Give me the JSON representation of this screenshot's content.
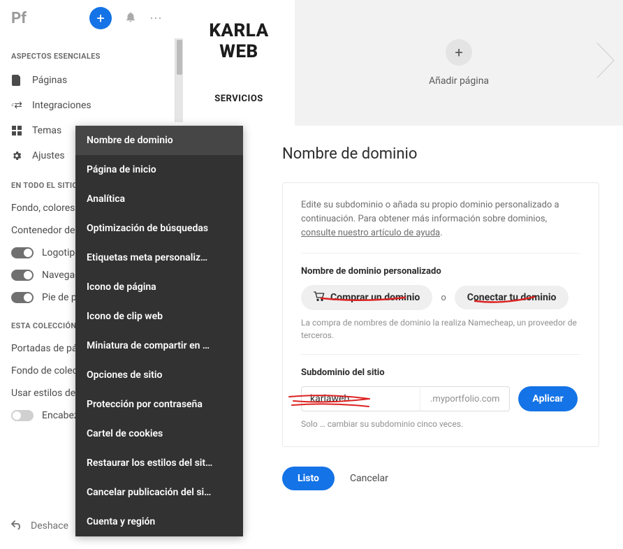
{
  "topbar": {
    "logo": "Pf"
  },
  "sidebar": {
    "section_essentials": "ASPECTOS ESENCIALES",
    "items": [
      {
        "label": "Páginas"
      },
      {
        "label": "Integraciones"
      },
      {
        "label": "Temas"
      },
      {
        "label": "Ajustes"
      }
    ],
    "section_sitewide": "EN TODO EL SITIO",
    "sitewide": [
      {
        "label": "Fondo, colores"
      },
      {
        "label": "Contenedor de"
      },
      {
        "label": "Logotipo",
        "toggle": true
      },
      {
        "label": "Navegaci",
        "toggle": true
      },
      {
        "label": "Pie de pá",
        "toggle": true
      }
    ],
    "section_collection": "ESTA COLECCIÓN",
    "collection": [
      {
        "label": "Portadas de pá"
      },
      {
        "label": "Fondo de colec"
      },
      {
        "label": "Usar estilos de"
      },
      {
        "label": "Encabeza",
        "toggle": false
      }
    ],
    "undo": "Deshace"
  },
  "site": {
    "title_line1": "KARLA",
    "title_line2": "WEB",
    "nav1": "SERVICIOS"
  },
  "canvas": {
    "add_page": "Añadir página"
  },
  "settings_menu": [
    "Nombre de dominio",
    "Página de inicio",
    "Analítica",
    "Optimización de búsquedas",
    "Etiquetas meta personaliz…",
    "Icono de página",
    "Icono de clip web",
    "Miniatura de compartir en …",
    "Opciones de sitio",
    "Protección por contraseña",
    "Cartel de cookies",
    "Restaurar los estilos del sit…",
    "Cancelar publicación del si…",
    "Cuenta y región"
  ],
  "domain": {
    "title": "Nombre de dominio",
    "desc_pre": "Edite su subdominio o añada su propio dominio personalizado a continuación. Para obtener más información sobre dominios, ",
    "desc_link": "consulte nuestro artículo de ayuda",
    "custom_label": "Nombre de dominio personalizado",
    "buy_btn": "Comprar un dominio",
    "or": "o",
    "connect_btn": "Conectar tu dominio",
    "buy_note": "La compra de nombres de dominio la realiza Namecheap, un proveedor de terceros.",
    "sub_label": "Subdominio del sitio",
    "sub_value": "karlaweb",
    "sub_suffix": ".myportfolio.com",
    "apply": "Aplicar",
    "sub_note": "Solo … cambiar su subdominio cinco veces.",
    "done": "Listo",
    "cancel": "Cancelar"
  }
}
